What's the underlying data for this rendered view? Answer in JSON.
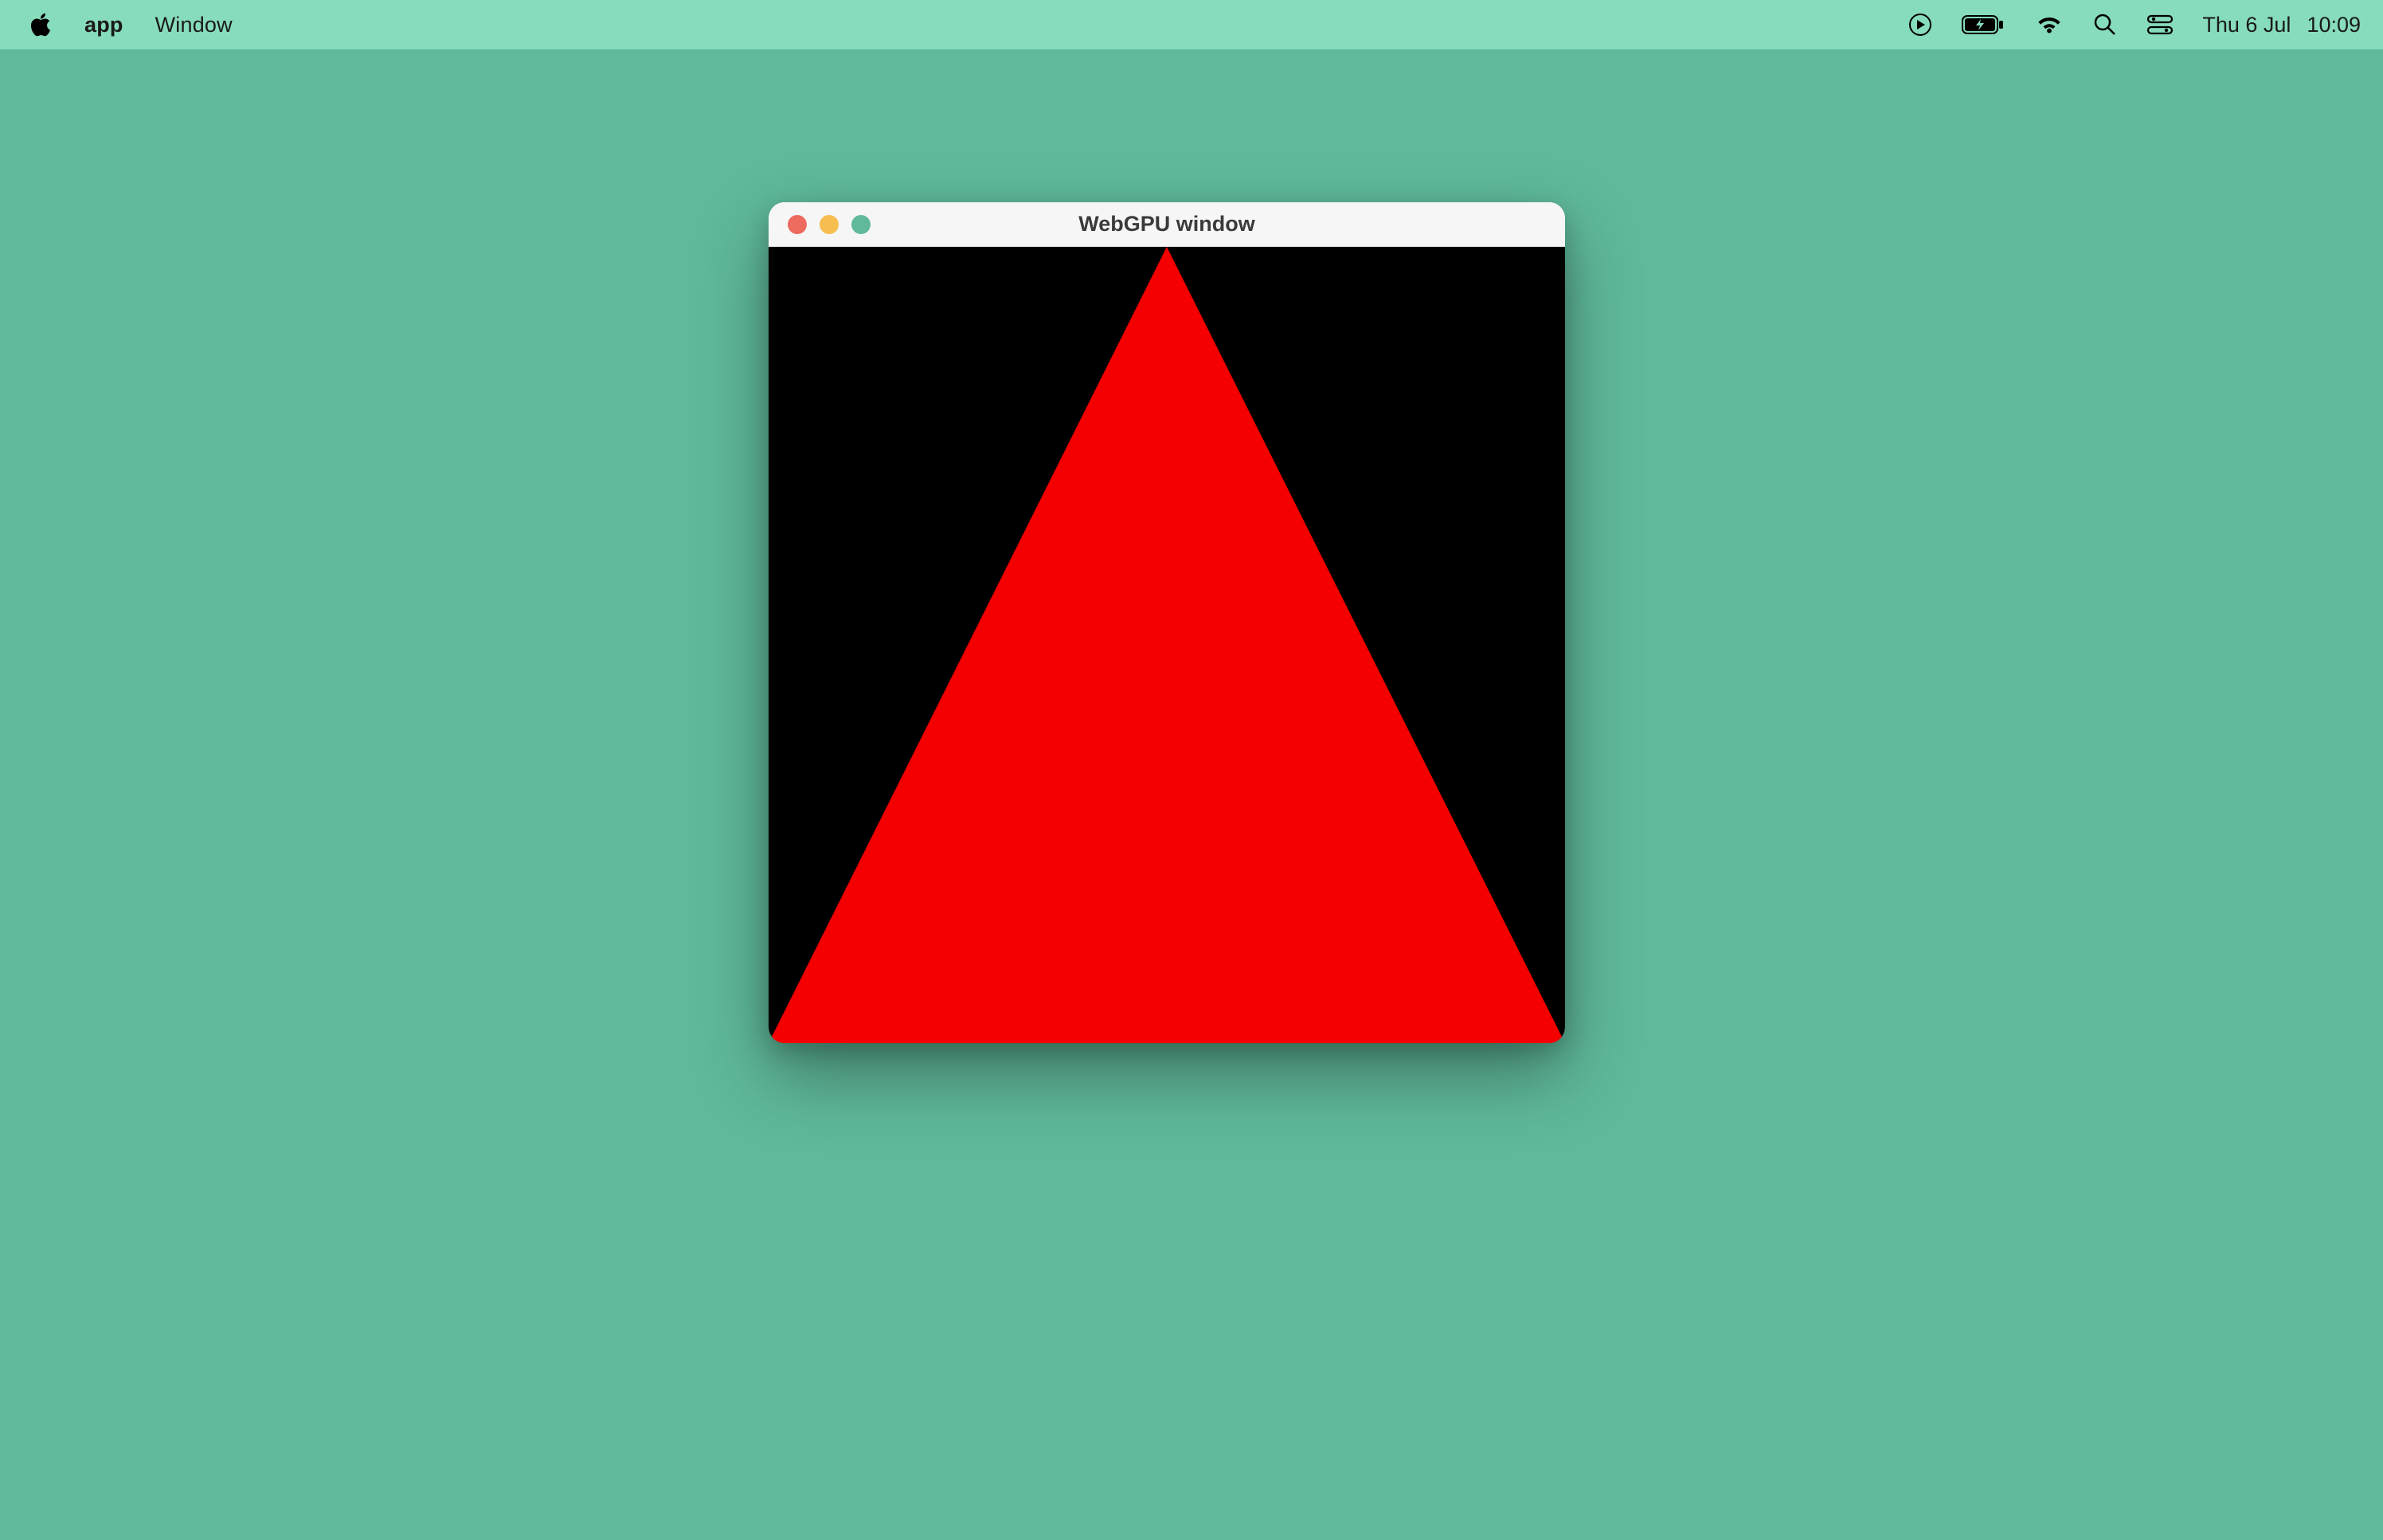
{
  "menubar": {
    "app_name": "app",
    "items": [
      "Window"
    ],
    "date": "Thu 6 Jul",
    "time": "10:09"
  },
  "window": {
    "title": "WebGPU window",
    "content": {
      "background_color": "#000000",
      "triangle_color": "#f40001"
    }
  },
  "colors": {
    "desktop": "#5fb99a",
    "menubar": "#86dcbb"
  }
}
